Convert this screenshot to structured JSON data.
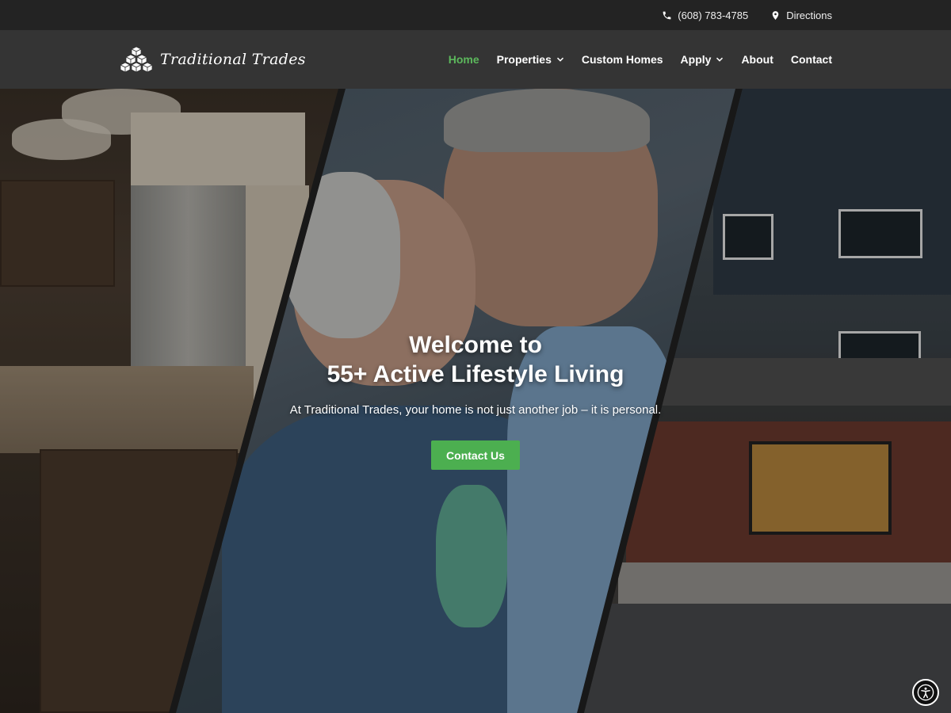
{
  "topbar": {
    "phone": "(608) 783-4785",
    "directions": "Directions",
    "phone_icon": "phone-icon",
    "directions_icon": "map-pin-icon"
  },
  "header": {
    "logo_text": "Traditional Trades",
    "nav": [
      {
        "label": "Home",
        "active": true,
        "dropdown": false
      },
      {
        "label": "Properties",
        "active": false,
        "dropdown": true
      },
      {
        "label": "Custom Homes",
        "active": false,
        "dropdown": false
      },
      {
        "label": "Apply",
        "active": false,
        "dropdown": true
      },
      {
        "label": "About",
        "active": false,
        "dropdown": false
      },
      {
        "label": "Contact",
        "active": false,
        "dropdown": false
      }
    ]
  },
  "hero": {
    "title_line1": "Welcome to",
    "title_line2": "55+ Active Lifestyle Living",
    "subtitle": "At Traditional Trades, your home is not just another job – it is personal.",
    "cta_label": "Contact Us"
  },
  "colors": {
    "accent": "#4caf50",
    "nav_active": "#5cb85c",
    "topbar_bg": "#232323",
    "navbar_bg": "#343434"
  },
  "accessibility": {
    "icon": "accessibility-icon"
  }
}
